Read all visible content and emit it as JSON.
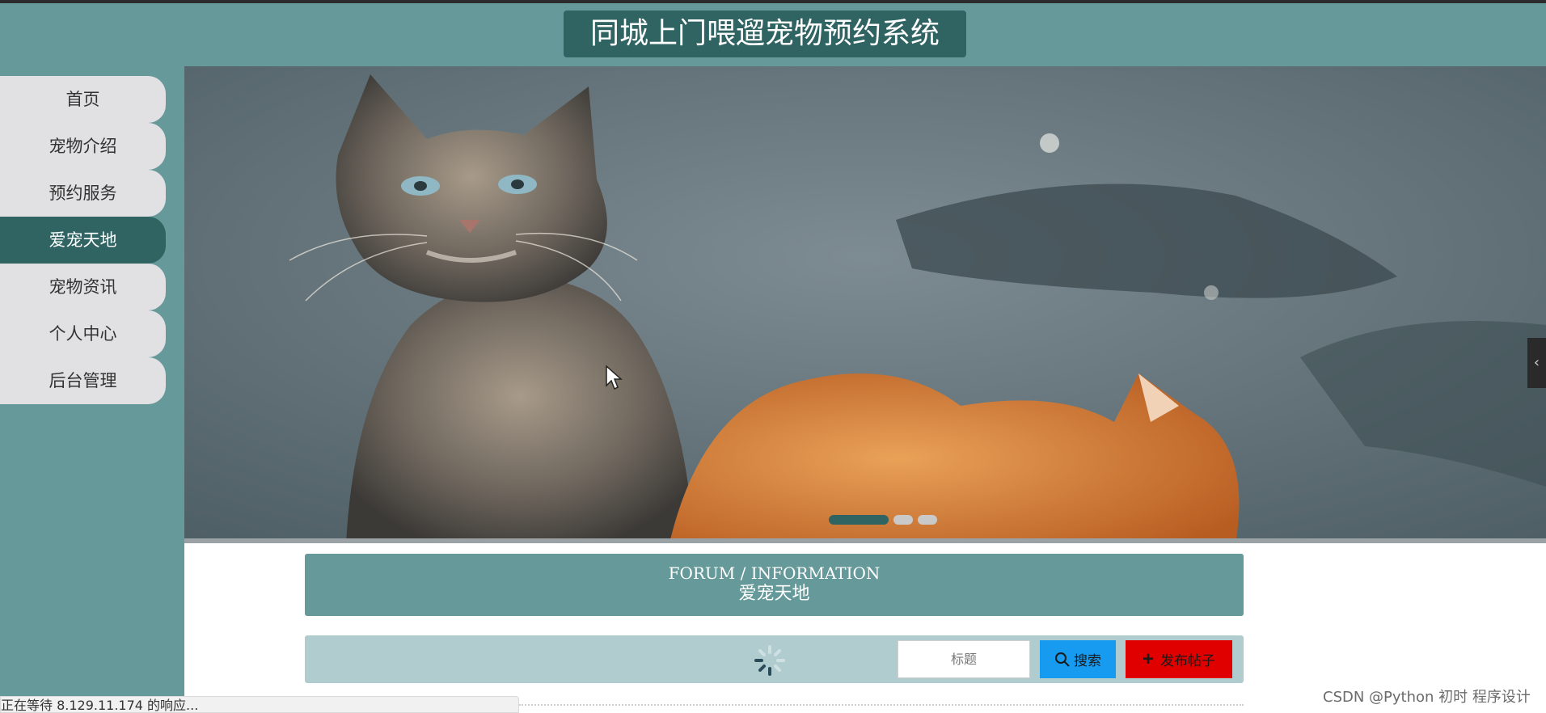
{
  "header": {
    "title": "同城上门喂遛宠物预约系统"
  },
  "sidebar": {
    "items": [
      {
        "label": "首页",
        "active": false
      },
      {
        "label": "宠物介绍",
        "active": false
      },
      {
        "label": "预约服务",
        "active": false
      },
      {
        "label": "爱宠天地",
        "active": true
      },
      {
        "label": "宠物资讯",
        "active": false
      },
      {
        "label": "个人中心",
        "active": false
      },
      {
        "label": "后台管理",
        "active": false
      }
    ]
  },
  "carousel": {
    "slide_count": 3,
    "active_index": 0
  },
  "section": {
    "title_en": "FORUM / INFORMATION",
    "title_cn": "爱宠天地"
  },
  "search": {
    "placeholder": "标题",
    "search_label": "搜索",
    "post_label": "发布帖子"
  },
  "status_bar": {
    "text": "正在等待 8.129.11.174 的响应..."
  },
  "watermark": {
    "text": "CSDN @Python 初时 程序设计"
  },
  "colors": {
    "teal": "#66999a",
    "teal_dark": "#2f6463",
    "search_blue": "#169bf0",
    "post_red": "#e00000"
  }
}
